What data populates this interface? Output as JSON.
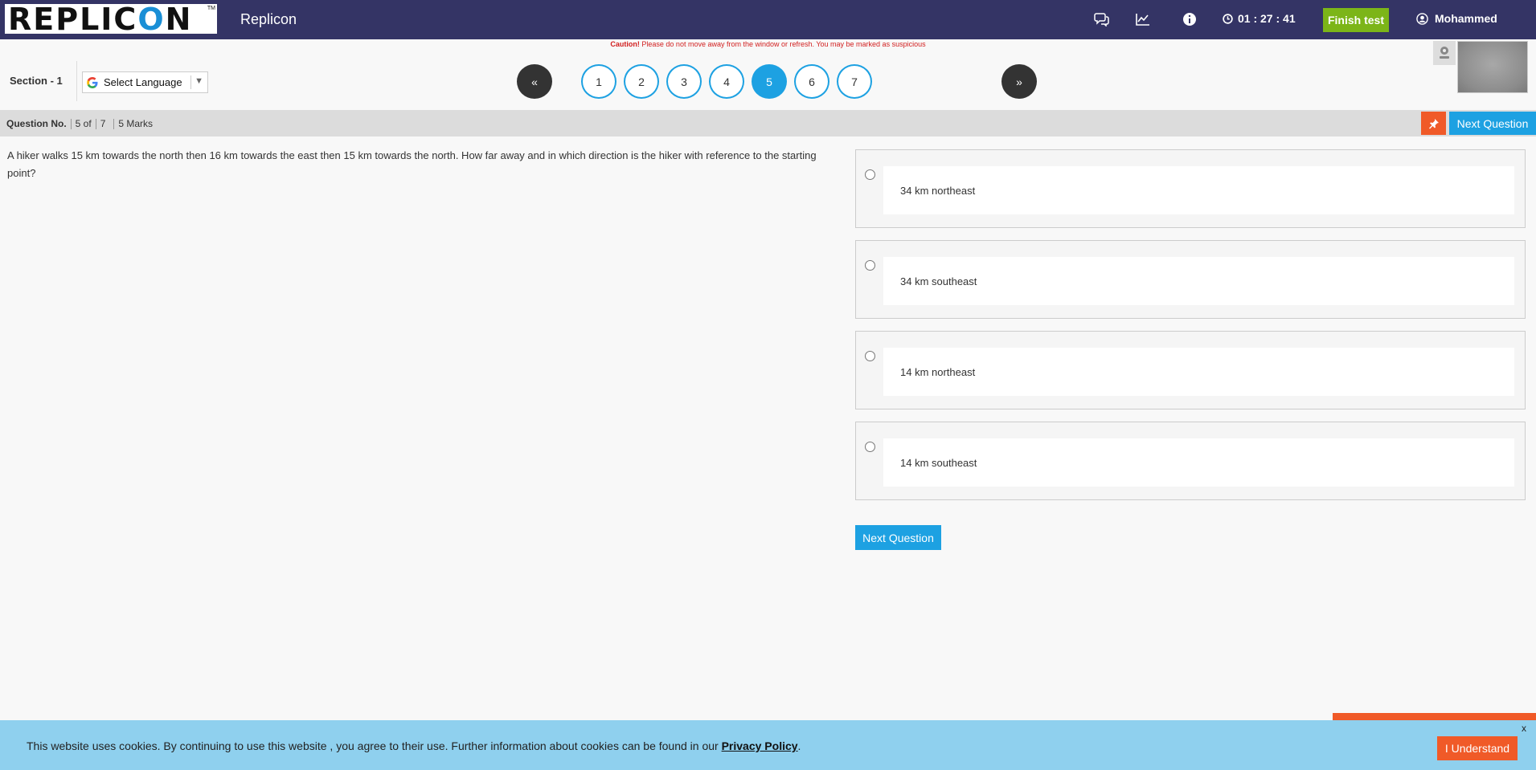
{
  "header": {
    "logo_text": "REPLICON",
    "logo_tm": "TM",
    "app_title": "Replicon",
    "icons": [
      "chat-icon",
      "chart-icon",
      "info-icon",
      "clock-icon",
      "user-icon"
    ],
    "timer": "01 : 27 : 41",
    "finish_label": "Finish test",
    "user_name": "Mohammed",
    "bg_color": "#343465"
  },
  "caution": {
    "label": "Caution!",
    "text": "Please do not move away from the window or refresh. You may be marked as suspicious"
  },
  "section": {
    "label": "Section - 1",
    "language_label": "Select Language"
  },
  "navigator": {
    "prev": "«",
    "next": "»",
    "questions": [
      "1",
      "2",
      "3",
      "4",
      "5",
      "6",
      "7"
    ],
    "active": "5",
    "accent": "#1da1e2"
  },
  "question_bar": {
    "label": "Question No.",
    "current": "5 of",
    "total": "7",
    "marks": "5 Marks",
    "next_label": "Next Question"
  },
  "question": {
    "text": "A hiker walks 15 km towards the north then 16 km towards the east then 15 km towards the north. How far away and in which direction is the hiker with reference to the starting point?"
  },
  "options": [
    "34 km northeast",
    "34 km southeast",
    "14 km northeast",
    "14 km southeast"
  ],
  "next_button_label": "Next Question",
  "cookie": {
    "text": "This website uses cookies. By continuing to use this website , you agree to their use. Further information about cookies can be found in our",
    "link": "Privacy Policy",
    "suffix": ".",
    "button": "I Understand",
    "close": "x"
  }
}
